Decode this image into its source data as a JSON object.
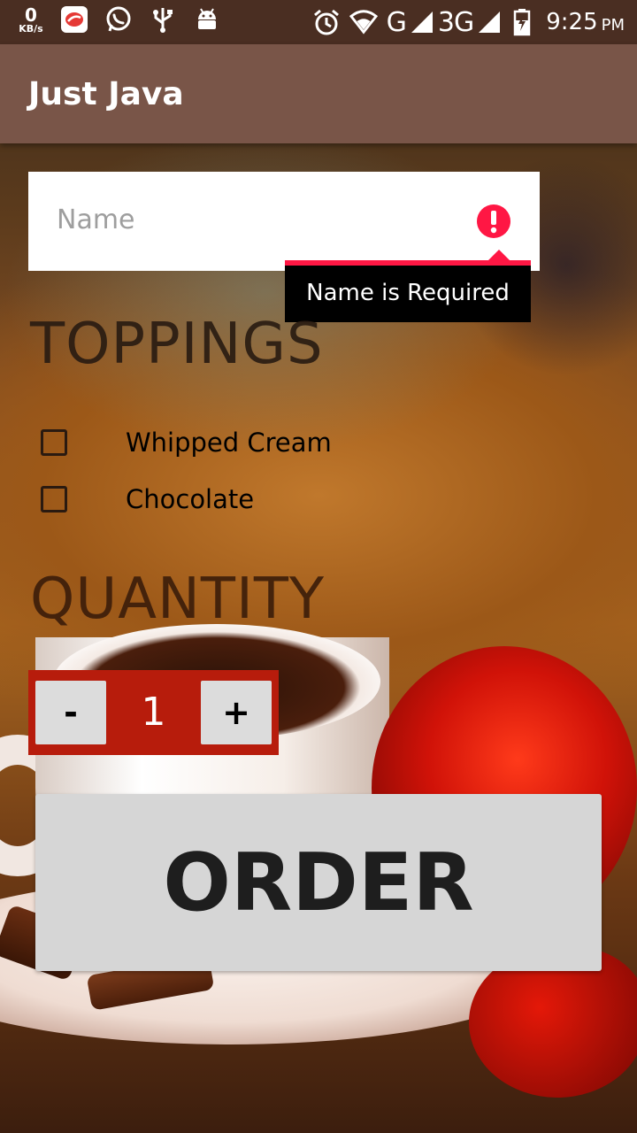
{
  "status_bar": {
    "net_speed": "0",
    "net_speed_unit": "KB/s",
    "network_g": "G",
    "network_3g": "3G",
    "time": "9:25",
    "ampm": "PM"
  },
  "app_bar": {
    "title": "Just Java"
  },
  "name_field": {
    "placeholder": "Name",
    "value": "",
    "error": "Name is Required"
  },
  "toppings": {
    "heading": "TOPPINGS",
    "items": [
      {
        "label": "Whipped Cream",
        "checked": false
      },
      {
        "label": "Chocolate",
        "checked": false
      }
    ]
  },
  "quantity": {
    "heading": "QUANTITY",
    "minus_label": "-",
    "value": "1",
    "plus_label": "+"
  },
  "order_button": {
    "label": "ORDER"
  },
  "colors": {
    "app_bar": "#795548",
    "status_bar": "#4a2e22",
    "error": "#ff1744",
    "stepper_bg": "#b71c0c",
    "button_bg": "#d6d6d6"
  }
}
